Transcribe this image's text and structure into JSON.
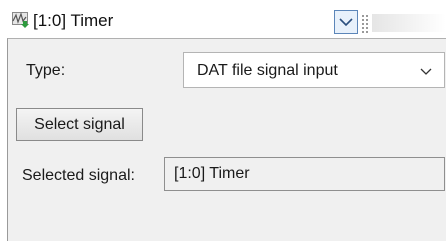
{
  "header": {
    "icon": "waveform-arrow-icon",
    "title": "[1:0] Timer",
    "collapse_icon": "chevron-down-icon"
  },
  "panel": {
    "type_label": "Type:",
    "type_value": "DAT file signal input",
    "select_signal_label": "Select signal",
    "selected_signal_label": "Selected signal:",
    "selected_signal_value": "[1:0] Timer"
  },
  "colors": {
    "panel_bg": "#f0f0f0",
    "collapse_button_border": "#5c86b9",
    "collapse_button_bg": "#e8f1fb"
  }
}
